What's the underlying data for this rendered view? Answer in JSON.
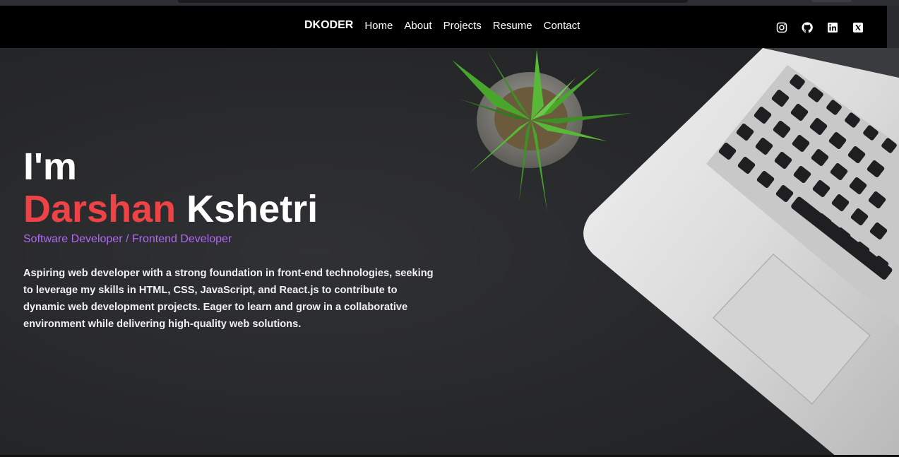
{
  "nav": {
    "brand": "DKODER",
    "links": [
      "Home",
      "About",
      "Projects",
      "Resume",
      "Contact"
    ]
  },
  "socials": [
    "instagram-icon",
    "github-icon",
    "linkedin-icon",
    "x-icon"
  ],
  "hero": {
    "intro": "I'm",
    "first_name": "Darshan",
    "last_name": "Kshetri",
    "subtitle": "Software Developer / Frontend Developer",
    "bio": "Aspiring web developer with a strong foundation in front-end technologies, seeking to leverage my skills in HTML, CSS, JavaScript, and React.js to contribute to dynamic web development projects. Eager to learn and grow in a collaborative environment while delivering high-quality web solutions."
  },
  "colors": {
    "accent_red": "#ee4346",
    "accent_purple": "#b069f0",
    "navbar": "#000000"
  }
}
